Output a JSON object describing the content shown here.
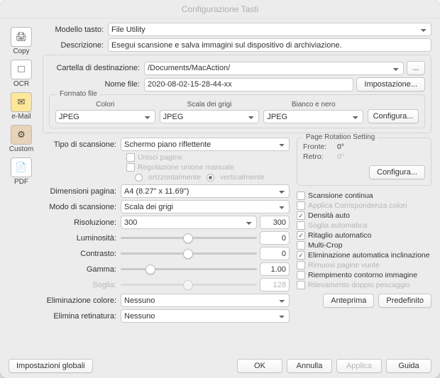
{
  "title": "Configurazione Tasti",
  "sidebar": {
    "items": [
      {
        "label": "Copy",
        "icon": "🖨"
      },
      {
        "label": "OCR",
        "icon": "🞎"
      },
      {
        "label": "e-Mail",
        "icon": "✉"
      },
      {
        "label": "Custom",
        "icon": "⚙"
      },
      {
        "label": "PDF",
        "icon": "📄"
      }
    ]
  },
  "top": {
    "model_label": "Modello tasto:",
    "model_value": "File Utility",
    "desc_label": "Descrizione:",
    "desc_value": "Esegui scansione e salva immagini sul dispositivo di archiviazione."
  },
  "dest": {
    "folder_label": "Cartella di destinazione:",
    "folder_value": "/Documents/MacAction/",
    "filename_label": "Nome file:",
    "filename_value": "2020-08-02-15-28-44-xx",
    "setup_btn": "Impostazione...",
    "browse_btn": "...",
    "file_format_group": "Formato file",
    "ff_headers": {
      "color": "Colori",
      "gray": "Scala dei grigi",
      "bw": "Bianco e nero"
    },
    "ff_values": {
      "color": "JPEG",
      "gray": "JPEG",
      "bw": "JPEG"
    },
    "ff_config": "Configura..."
  },
  "scan": {
    "type_label": "Tipo di scansione:",
    "type_value": "Schermo piano riflettente",
    "merge": "Unisci pagine",
    "manual": "Regolazione unione manuale",
    "horiz": "orizzontalmente",
    "vert": "verticalmente",
    "page_size_label": "Dimensioni pagina:",
    "page_size_value": "A4 (8.27\" x 11.69\")",
    "mode_label": "Modo di scansione:",
    "mode_value": "Scala dei grigi",
    "res_label": "Risoluzione:",
    "res_value": "300",
    "res_num": "300",
    "bright_label": "Luminosità:",
    "bright_val": "0",
    "contrast_label": "Contrasto:",
    "contrast_val": "0",
    "gamma_label": "Gamma:",
    "gamma_val": "1.00",
    "thresh_label": "Soglia:",
    "thresh_val": "128",
    "dropout_label": "Eliminazione colore:",
    "dropout_value": "Nessuno",
    "descreen_label": "Elimina retinatura:",
    "descreen_value": "Nessuno"
  },
  "rot": {
    "title": "Page Rotation Setting",
    "front_k": "Fronte:",
    "front_v": "0°",
    "rear_k": "Retro:",
    "rear_v": "0°",
    "config": "Configura..."
  },
  "opts": {
    "continuous": "Scansione continua",
    "colormatch": "Applica Corrispondenza colori",
    "autodensity": "Densità auto",
    "autothresh": "Soglia automatica",
    "autocrop": "Ritaglio automatico",
    "multicrop": "Multi-Crop",
    "deskew": "Eliminazione automatica inclinazione",
    "blank": "Rimuovi pagine vuote",
    "fill": "Riempimento contorno immagine",
    "multifeed": "Rilevamento doppio pescaggio"
  },
  "buttons": {
    "preview": "Anteprima",
    "default": "Predefinito",
    "global": "Impostazioni globali",
    "ok": "OK",
    "cancel": "Annulla",
    "apply": "Applica",
    "guide": "Guida"
  }
}
